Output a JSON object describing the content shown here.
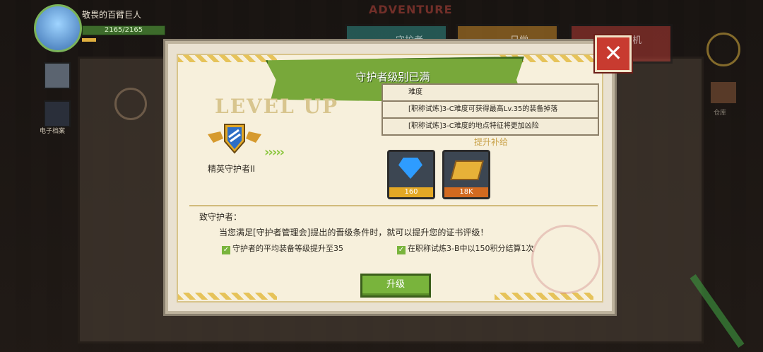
{
  "player": {
    "name": "敬畏的百臂巨人",
    "hp_text": "2165/2165"
  },
  "sidebar": {
    "item_label": "电子档案"
  },
  "header": {
    "adventure_text": "ADVENTURE",
    "tabs": [
      {
        "label": "守护者"
      },
      {
        "label": "日常"
      },
      {
        "label": "危机"
      }
    ]
  },
  "right": {
    "store_label": "仓库"
  },
  "dialog": {
    "title": "守护者级别已满",
    "close_label": "✕",
    "levelup_text": "LEVEL UP",
    "arrows": "›››››",
    "rank_name": "精英守护者II",
    "info_rows": [
      {
        "text": "难度"
      },
      {
        "text": "[职称试炼]3-C难度可获得最高Lv.35的装备掉落"
      },
      {
        "text": "[职称试炼]3-C难度的地点特征将更加凶险"
      }
    ],
    "supply_title": "提升补给",
    "rewards": [
      {
        "icon": "gem-icon",
        "count": "160"
      },
      {
        "icon": "gold-bar-icon",
        "count": "18K"
      }
    ],
    "greeting": "致守护者：",
    "message": "当您满足[守护者管理会]提出的晋级条件时，就可以提升您的证书评级！",
    "conditions": [
      {
        "text": "守护者的平均装备等级提升至35"
      },
      {
        "text": "在职称试炼3-B中以150积分结算1次"
      }
    ],
    "upgrade_label": "升级"
  },
  "colors": {
    "ribbon": "#78a83a",
    "close": "#c83b30",
    "button": "#79b43c"
  }
}
